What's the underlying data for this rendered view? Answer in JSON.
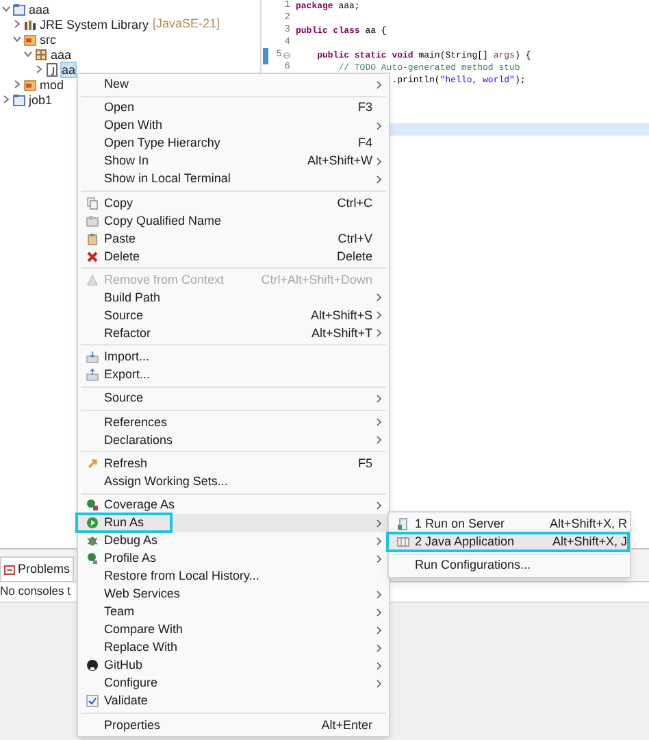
{
  "project_tree": [
    {
      "label": "aaa",
      "expanded": true,
      "selected": false,
      "children": [
        {
          "label": "JRE System Library",
          "decoration": "[JavaSE-21]",
          "expanded": false,
          "selected": false
        },
        {
          "label": "src",
          "expanded": true,
          "selected": false,
          "children": [
            {
              "label": "aaa",
              "expanded": true,
              "selected": false,
              "children": [
                {
                  "label": "aa",
                  "expanded": false,
                  "selected": true
                }
              ]
            }
          ]
        },
        {
          "label": "mod",
          "expanded": false,
          "selected": false
        }
      ]
    },
    {
      "label": "job1",
      "expanded": false,
      "selected": false
    }
  ],
  "editor": {
    "lines": [
      {
        "number": "1",
        "current": false,
        "segments": [
          {
            "kind": "keyword",
            "text": "package"
          },
          {
            "kind": "plain",
            "text": " aaa;"
          }
        ]
      },
      {
        "number": "2",
        "current": false
      },
      {
        "number": "3",
        "current": false,
        "segments": [
          {
            "kind": "keyword",
            "text": "public class"
          },
          {
            "kind": "plain",
            "text": " aa {"
          }
        ]
      },
      {
        "number": "4",
        "current": false
      },
      {
        "number": "5",
        "current": false,
        "collapsible": true,
        "segments": [
          {
            "kind": "keyword",
            "text": "    public static void"
          },
          {
            "kind": "plain",
            "text": " main(String[] "
          },
          {
            "kind": "param",
            "text": "args"
          },
          {
            "kind": "plain",
            "text": ") {"
          }
        ]
      },
      {
        "number": "6",
        "current": false,
        "segments": [
          {
            "kind": "comment",
            "text": "        // TODO Auto-generated method stub"
          }
        ]
      },
      {
        "current": false,
        "segments": [
          {
            "kind": "plain",
            "text": "                  .println("
          },
          {
            "kind": "string",
            "text": "\"hello, world\""
          },
          {
            "kind": "plain",
            "text": ");"
          }
        ]
      },
      {
        "current": false
      },
      {
        "current": false
      },
      {
        "current": false
      },
      {
        "current": true
      }
    ]
  },
  "bottom_panel": {
    "tabs": [
      {
        "label": "Problems",
        "selected": true
      }
    ],
    "message": "No consoles t"
  },
  "context_menu": {
    "items": [
      {
        "kind": "item",
        "label": "New",
        "submenu": true,
        "disabled": false,
        "selected": false
      },
      {
        "kind": "separator"
      },
      {
        "kind": "item",
        "label": "Open",
        "shortcut": "F3",
        "submenu": false,
        "disabled": false,
        "selected": false
      },
      {
        "kind": "item",
        "label": "Open With",
        "submenu": true,
        "disabled": false,
        "selected": false
      },
      {
        "kind": "item",
        "label": "Open Type Hierarchy",
        "shortcut": "F4",
        "submenu": false,
        "disabled": false,
        "selected": false
      },
      {
        "kind": "item",
        "label": "Show In",
        "shortcut": "Alt+Shift+W",
        "submenu": true,
        "disabled": false,
        "selected": false
      },
      {
        "kind": "item",
        "label": "Show in Local Terminal",
        "submenu": true,
        "disabled": false,
        "selected": false
      },
      {
        "kind": "separator"
      },
      {
        "kind": "item",
        "label": "Copy",
        "shortcut": "Ctrl+C",
        "submenu": false,
        "disabled": false,
        "selected": false
      },
      {
        "kind": "item",
        "label": "Copy Qualified Name",
        "submenu": false,
        "disabled": false,
        "selected": false
      },
      {
        "kind": "item",
        "label": "Paste",
        "shortcut": "Ctrl+V",
        "submenu": false,
        "disabled": false,
        "selected": false
      },
      {
        "kind": "item",
        "label": "Delete",
        "shortcut": "Delete",
        "submenu": false,
        "disabled": false,
        "selected": false
      },
      {
        "kind": "separator"
      },
      {
        "kind": "item",
        "label": "Remove from Context",
        "shortcut": "Ctrl+Alt+Shift+Down",
        "submenu": false,
        "disabled": true,
        "selected": false
      },
      {
        "kind": "item",
        "label": "Build Path",
        "submenu": true,
        "disabled": false,
        "selected": false
      },
      {
        "kind": "item",
        "label": "Source",
        "shortcut": "Alt+Shift+S",
        "submenu": true,
        "disabled": false,
        "selected": false
      },
      {
        "kind": "item",
        "label": "Refactor",
        "shortcut": "Alt+Shift+T",
        "submenu": true,
        "disabled": false,
        "selected": false
      },
      {
        "kind": "separator"
      },
      {
        "kind": "item",
        "label": "Import...",
        "submenu": false,
        "disabled": false,
        "selected": false
      },
      {
        "kind": "item",
        "label": "Export...",
        "submenu": false,
        "disabled": false,
        "selected": false
      },
      {
        "kind": "separator"
      },
      {
        "kind": "item",
        "label": "Source",
        "submenu": true,
        "disabled": false,
        "selected": false
      },
      {
        "kind": "separator"
      },
      {
        "kind": "item",
        "label": "References",
        "submenu": true,
        "disabled": false,
        "selected": false
      },
      {
        "kind": "item",
        "label": "Declarations",
        "submenu": true,
        "disabled": false,
        "selected": false
      },
      {
        "kind": "separator"
      },
      {
        "kind": "item",
        "label": "Refresh",
        "shortcut": "F5",
        "submenu": false,
        "disabled": false,
        "selected": false
      },
      {
        "kind": "item",
        "label": "Assign Working Sets...",
        "submenu": false,
        "disabled": false,
        "selected": false
      },
      {
        "kind": "separator"
      },
      {
        "kind": "item",
        "label": "Coverage As",
        "submenu": true,
        "disabled": false,
        "selected": false
      },
      {
        "kind": "item",
        "label": "Run As",
        "submenu": true,
        "disabled": false,
        "selected": true
      },
      {
        "kind": "item",
        "label": "Debug As",
        "submenu": true,
        "disabled": false,
        "selected": false
      },
      {
        "kind": "item",
        "label": "Profile As",
        "submenu": true,
        "disabled": false,
        "selected": false
      },
      {
        "kind": "item",
        "label": "Restore from Local History...",
        "submenu": false,
        "disabled": false,
        "selected": false
      },
      {
        "kind": "item",
        "label": "Web Services",
        "submenu": true,
        "disabled": false,
        "selected": false
      },
      {
        "kind": "item",
        "label": "Team",
        "submenu": true,
        "disabled": false,
        "selected": false
      },
      {
        "kind": "item",
        "label": "Compare With",
        "submenu": true,
        "disabled": false,
        "selected": false
      },
      {
        "kind": "item",
        "label": "Replace With",
        "submenu": true,
        "disabled": false,
        "selected": false
      },
      {
        "kind": "item",
        "label": "GitHub",
        "submenu": true,
        "disabled": false,
        "selected": false
      },
      {
        "kind": "item",
        "label": "Configure",
        "submenu": true,
        "disabled": false,
        "selected": false
      },
      {
        "kind": "item",
        "label": "Validate",
        "submenu": false,
        "disabled": false,
        "selected": false
      },
      {
        "kind": "separator"
      },
      {
        "kind": "item",
        "label": "Properties",
        "shortcut": "Alt+Enter",
        "submenu": false,
        "disabled": false,
        "selected": false
      }
    ]
  },
  "run_as_submenu": {
    "items": [
      {
        "kind": "item",
        "label": "1 Run on Server",
        "shortcut": "Alt+Shift+X, R",
        "selected": false
      },
      {
        "kind": "item",
        "label": "2 Java Application",
        "shortcut": "Alt+Shift+X, J",
        "selected": true
      },
      {
        "kind": "separator"
      },
      {
        "kind": "item",
        "label": "Run Configurations...",
        "selected": false
      }
    ]
  }
}
